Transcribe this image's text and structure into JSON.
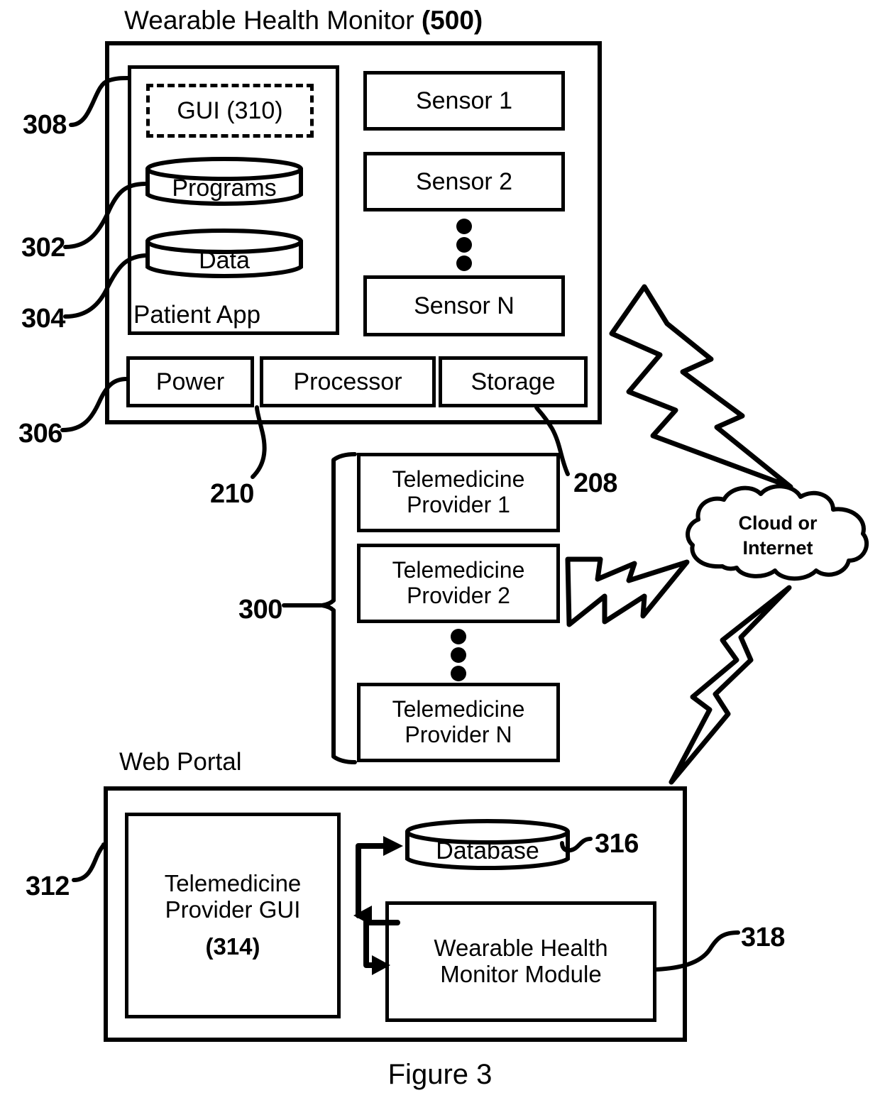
{
  "figure": {
    "caption": "Figure 3"
  },
  "device": {
    "title_text": "Wearable Health Monitor",
    "title_ref": "(500)",
    "ref_308": "308",
    "ref_302": "302",
    "ref_304": "304",
    "ref_306": "306",
    "ref_210": "210",
    "ref_208": "208",
    "patient_app_label": "Patient App",
    "gui_label": "GUI (",
    "gui_ref": "310",
    "gui_label_end": ")",
    "gui_full": "GUI (310)",
    "programs_label": "Programs",
    "data_label": "Data",
    "sensors": [
      {
        "label": "Sensor 1"
      },
      {
        "label": "Sensor 2"
      },
      {
        "label": "Sensor N"
      }
    ],
    "hardware": [
      {
        "label": "Power"
      },
      {
        "label": "Processor"
      },
      {
        "label": "Storage"
      }
    ]
  },
  "providers": {
    "group_ref": "300",
    "items": [
      {
        "line1": "Telemedicine",
        "line2": "Provider 1"
      },
      {
        "line1": "Telemedicine",
        "line2": "Provider 2"
      },
      {
        "line1": "Telemedicine",
        "line2": "Provider N"
      }
    ]
  },
  "cloud": {
    "line1": "Cloud or",
    "line2": "Internet"
  },
  "portal": {
    "title": "Web Portal",
    "ref_312": "312",
    "ref_316": "316",
    "ref_318": "318",
    "gui": {
      "line1": "Telemedicine",
      "line2": "Provider GUI",
      "ref": "(314)"
    },
    "database_label": "Database",
    "module": {
      "line1": "Wearable Health",
      "line2": "Monitor Module"
    }
  },
  "colors": {
    "ink": "#000000",
    "paper": "#ffffff"
  }
}
